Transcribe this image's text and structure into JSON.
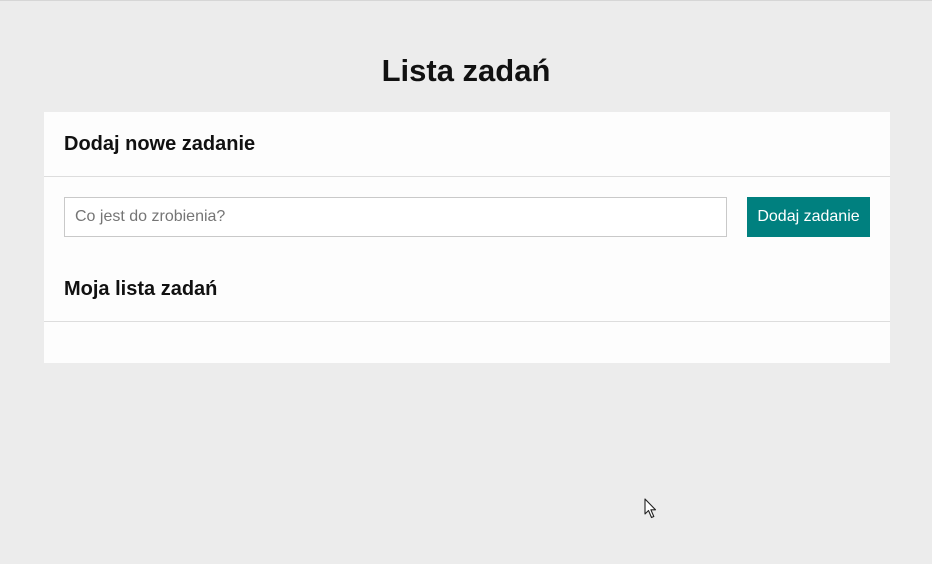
{
  "page": {
    "title": "Lista zadań"
  },
  "add_section": {
    "heading": "Dodaj nowe zadanie",
    "input_value": "",
    "input_placeholder": "Co jest do zrobienia?",
    "button_label": "Dodaj zadanie"
  },
  "list_section": {
    "heading": "Moja lista zadań",
    "items": []
  },
  "colors": {
    "background": "#ececec",
    "card": "#fdfdfd",
    "accent": "#00807f",
    "button_text": "#ffffff"
  },
  "icons": {
    "cursor": "mouse-pointer-icon"
  }
}
